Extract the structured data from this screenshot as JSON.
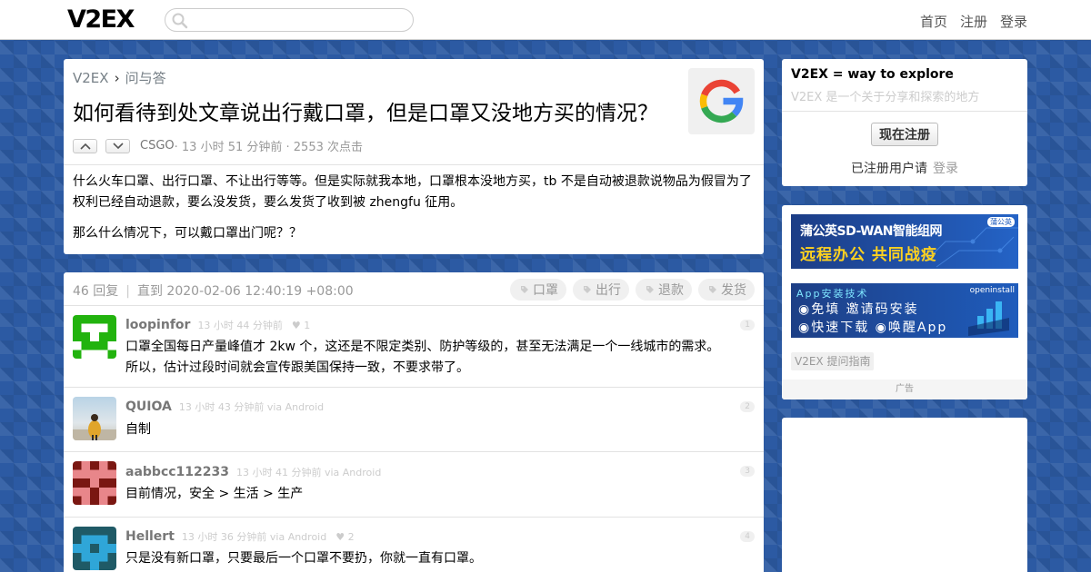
{
  "site": {
    "logo": "V2EX"
  },
  "nav": {
    "home": "首页",
    "register": "注册",
    "login": "登录"
  },
  "topic": {
    "breadcrumb_home": "V2EX",
    "breadcrumb_sep": "›",
    "breadcrumb_node": "问与答",
    "title": "如何看待到处文章说出行戴口罩，但是口罩又没地方买的情况？",
    "author": "CSGO",
    "meta_rest": " · 13 小时 51 分钟前 · 2553 次点击",
    "para1": "什么火车口罩、出行口罩、不让出行等等。但是实际就我本地，口罩根本没地方买，tb 不是自动被退款说物品为假冒为了权利已经自动退款，要么没发货，要么发货了收到被 zhengfu 征用。",
    "para2": "那么什么情况下，可以戴口罩出门呢？？"
  },
  "replies_header": {
    "count": "46 回复",
    "sep": "|",
    "until": "直到 2020-02-06 12:40:19 +08:00",
    "tags": [
      "口罩",
      "出行",
      "退款",
      "发货"
    ]
  },
  "replies": [
    {
      "user": "loopinfor",
      "time": "13 小时 44 分钟前",
      "likes": "♥ 1",
      "no": "1",
      "line1": "口罩全国每日产量峰值才 2kw 个，这还是不限定类别、防护等级的，甚至无法满足一个一线城市的需求。",
      "line2": "所以，估计过段时间就会宣传跟美国保持一致，不要求带了。"
    },
    {
      "user": "QUIOA",
      "time": "13 小时 43 分钟前 via Android",
      "likes": "",
      "no": "2",
      "line1": "自制",
      "line2": ""
    },
    {
      "user": "aabbcc112233",
      "time": "13 小时 41 分钟前 via Android",
      "likes": "",
      "no": "3",
      "line1": "目前情况，安全 > 生活 > 生产",
      "line2": ""
    },
    {
      "user": "Hellert",
      "time": "13 小时 36 分钟前 via Android",
      "likes": "♥ 2",
      "no": "4",
      "line1": "只是没有新口罩，只要最后一个口罩不要扔，你就一直有口罩。",
      "line2": ""
    }
  ],
  "sidebar": {
    "title": "V2EX = way to explore",
    "subtitle": "V2EX 是一个关于分享和探索的地方",
    "register_button": "现在注册",
    "registered_text": "已注册用户请",
    "login_link": "登录",
    "ad1_line1": "蒲公英SD-WAN智能组网",
    "ad1_line2": "远程办公 共同战疫",
    "ad1_badge": "蒲公英",
    "ad2_line1": "App安装技术",
    "ad2_line2": "◉免填 邀请码安装",
    "ad2_line3": "◉快速下载 ◉唤醒App",
    "ad2_badge": "openinstall",
    "guide": "V2EX 提问指南",
    "ad_label": "广告"
  },
  "colors": {
    "accent": "#2c5aa3",
    "muted": "#999999",
    "google_blue": "#4285F4",
    "google_red": "#EA4335",
    "google_yellow": "#FBBC05",
    "google_green": "#34A853"
  }
}
